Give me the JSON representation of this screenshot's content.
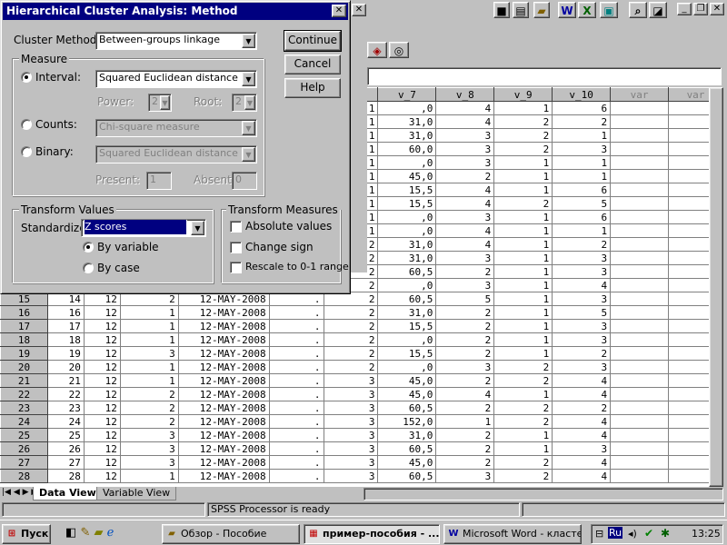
{
  "dialog": {
    "title": "Hierarchical Cluster Analysis: Method",
    "cluster_method_label": "Cluster Method:",
    "cluster_method_value": "Between-groups linkage",
    "buttons": {
      "continue": "Continue",
      "cancel": "Cancel",
      "help": "Help"
    },
    "measure": {
      "title": "Measure",
      "interval_label": "Interval:",
      "interval_value": "Squared Euclidean distance",
      "power_label": "Power:",
      "power_value": "2",
      "root_label": "Root:",
      "root_value": "2",
      "counts_label": "Counts:",
      "counts_value": "Chi-square measure",
      "binary_label": "Binary:",
      "binary_value": "Squared Euclidean distance",
      "present_label": "Present:",
      "present_value": "1",
      "absent_label": "Absent:",
      "absent_value": "0",
      "selected": "interval"
    },
    "transform_values": {
      "title": "Transform Values",
      "standardize_label": "Standardize:",
      "standardize_value": "Z scores",
      "by_variable": "By variable",
      "by_case": "By case",
      "selected": "by_variable"
    },
    "transform_measures": {
      "title": "Transform Measures",
      "absolute": "Absolute values",
      "change_sign": "Change sign",
      "rescale": "Rescale to 0-1 range"
    }
  },
  "grid": {
    "headers": [
      "v_7",
      "v_8",
      "v_9",
      "v_10",
      "var",
      "var"
    ],
    "top_rows": [
      [
        "1",
        ",0",
        "4",
        "1",
        "6"
      ],
      [
        "1",
        "31,0",
        "4",
        "2",
        "2"
      ],
      [
        "1",
        "31,0",
        "3",
        "2",
        "1"
      ],
      [
        "1",
        "60,0",
        "3",
        "2",
        "3"
      ],
      [
        "1",
        ",0",
        "3",
        "1",
        "1"
      ],
      [
        "1",
        "45,0",
        "2",
        "1",
        "1"
      ],
      [
        "1",
        "15,5",
        "4",
        "1",
        "6"
      ],
      [
        "1",
        "15,5",
        "4",
        "2",
        "5"
      ],
      [
        "1",
        ",0",
        "3",
        "1",
        "6"
      ],
      [
        "1",
        ",0",
        "4",
        "1",
        "1"
      ],
      [
        "2",
        "31,0",
        "4",
        "1",
        "2"
      ],
      [
        "2",
        "31,0",
        "3",
        "1",
        "3"
      ],
      [
        "2",
        "60,5",
        "2",
        "1",
        "3"
      ],
      [
        "2",
        ",0",
        "3",
        "1",
        "4"
      ]
    ],
    "rows": [
      [
        "15",
        "14",
        "12",
        "2",
        "12-MAY-2008",
        ".",
        "2",
        "60,5",
        "5",
        "1",
        "3"
      ],
      [
        "16",
        "16",
        "12",
        "1",
        "12-MAY-2008",
        ".",
        "2",
        "31,0",
        "2",
        "1",
        "5"
      ],
      [
        "17",
        "17",
        "12",
        "1",
        "12-MAY-2008",
        ".",
        "2",
        "15,5",
        "2",
        "1",
        "3"
      ],
      [
        "18",
        "18",
        "12",
        "1",
        "12-MAY-2008",
        ".",
        "2",
        ",0",
        "2",
        "1",
        "3"
      ],
      [
        "19",
        "19",
        "12",
        "3",
        "12-MAY-2008",
        ".",
        "2",
        "15,5",
        "2",
        "1",
        "2"
      ],
      [
        "20",
        "20",
        "12",
        "1",
        "12-MAY-2008",
        ".",
        "2",
        ",0",
        "3",
        "2",
        "3"
      ],
      [
        "21",
        "21",
        "12",
        "1",
        "12-MAY-2008",
        ".",
        "3",
        "45,0",
        "2",
        "2",
        "4"
      ],
      [
        "22",
        "22",
        "12",
        "2",
        "12-MAY-2008",
        ".",
        "3",
        "45,0",
        "4",
        "1",
        "4"
      ],
      [
        "23",
        "23",
        "12",
        "2",
        "12-MAY-2008",
        ".",
        "3",
        "60,5",
        "2",
        "2",
        "2"
      ],
      [
        "24",
        "24",
        "12",
        "2",
        "12-MAY-2008",
        ".",
        "3",
        "152,0",
        "1",
        "2",
        "4"
      ],
      [
        "25",
        "25",
        "12",
        "3",
        "12-MAY-2008",
        ".",
        "3",
        "31,0",
        "2",
        "1",
        "4"
      ],
      [
        "26",
        "26",
        "12",
        "3",
        "12-MAY-2008",
        ".",
        "3",
        "60,5",
        "2",
        "1",
        "3"
      ],
      [
        "27",
        "27",
        "12",
        "3",
        "12-MAY-2008",
        ".",
        "3",
        "45,0",
        "2",
        "2",
        "4"
      ],
      [
        "28",
        "28",
        "12",
        "1",
        "12-MAY-2008",
        ".",
        "3",
        "60,5",
        "3",
        "2",
        "4"
      ]
    ]
  },
  "tabs": {
    "data_view": "Data View",
    "variable_view": "Variable View"
  },
  "status": {
    "text": "SPSS Processor  is ready"
  },
  "taskbar": {
    "start": "Пуск",
    "tasks": [
      "Обзор - Пособие",
      "пример-пособия - ...",
      "Microsoft Word - класте..."
    ],
    "lang": "Ru",
    "clock": "13:25"
  },
  "colors": {
    "titlebar": "#000080",
    "selection": "#000080",
    "face": "#c0c0c0"
  }
}
